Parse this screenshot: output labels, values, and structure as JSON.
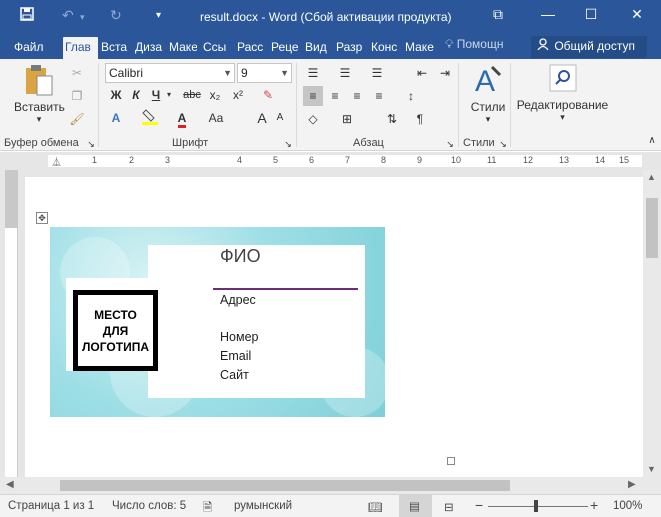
{
  "titlebar": {
    "title": "result.docx - Word (Сбой активации продукта)",
    "save_icon": "save-icon",
    "undo_icon": "undo-icon",
    "redo_icon": "redo-icon",
    "window_buttons": {
      "ribbon": "⧉",
      "minimize": "—",
      "maximize": "☐",
      "close": "✕"
    }
  },
  "tabs": [
    {
      "label": "Файл"
    },
    {
      "label": "Глав"
    },
    {
      "label": "Вста"
    },
    {
      "label": "Диза"
    },
    {
      "label": "Маке"
    },
    {
      "label": "Ссы"
    },
    {
      "label": "Расс"
    },
    {
      "label": "Реце"
    },
    {
      "label": "Вид"
    },
    {
      "label": "Разр"
    },
    {
      "label": "Конс"
    },
    {
      "label": "Маке"
    }
  ],
  "tell_me": "Помощн",
  "share": "Общий доступ",
  "ribbon": {
    "clipboard": {
      "paste_label": "Вставить",
      "group": "Буфер обмена"
    },
    "font": {
      "name": "Calibri",
      "size": "9",
      "group": "Шрифт",
      "bold": "Ж",
      "italic": "К",
      "underline": "Ч",
      "strike": "abc",
      "subscript": "x₂",
      "superscript": "x²",
      "grow": "A",
      "shrink": "A",
      "case": "Aa"
    },
    "paragraph": {
      "group": "Абзац",
      "pilcrow": "¶"
    },
    "styles": {
      "label": "Стили",
      "group": "Стили"
    },
    "editing": {
      "label": "Редактирование"
    }
  },
  "ruler_numbers": [
    "1",
    "2",
    "3",
    "4",
    "5",
    "6",
    "7",
    "8",
    "9",
    "10",
    "11",
    "12",
    "13",
    "14",
    "15"
  ],
  "card": {
    "name": "ФИО",
    "address": "Адрес",
    "phone": "Номер",
    "email": "Email",
    "site": "Сайт",
    "logo_line1": "МЕСТО",
    "logo_line2": "ДЛЯ",
    "logo_line3": "ЛОГОТИПА",
    "accent_color": "#6f2c78"
  },
  "statusbar": {
    "page": "Страница 1 из 1",
    "words": "Число слов: 5",
    "language": "румынский",
    "zoom": "100%",
    "zoom_minus": "−",
    "zoom_plus": "+"
  },
  "colors": {
    "title_bar": "#2b579a",
    "ribbon": "#f3f3f3",
    "card_bg": "#9fdfe6"
  }
}
